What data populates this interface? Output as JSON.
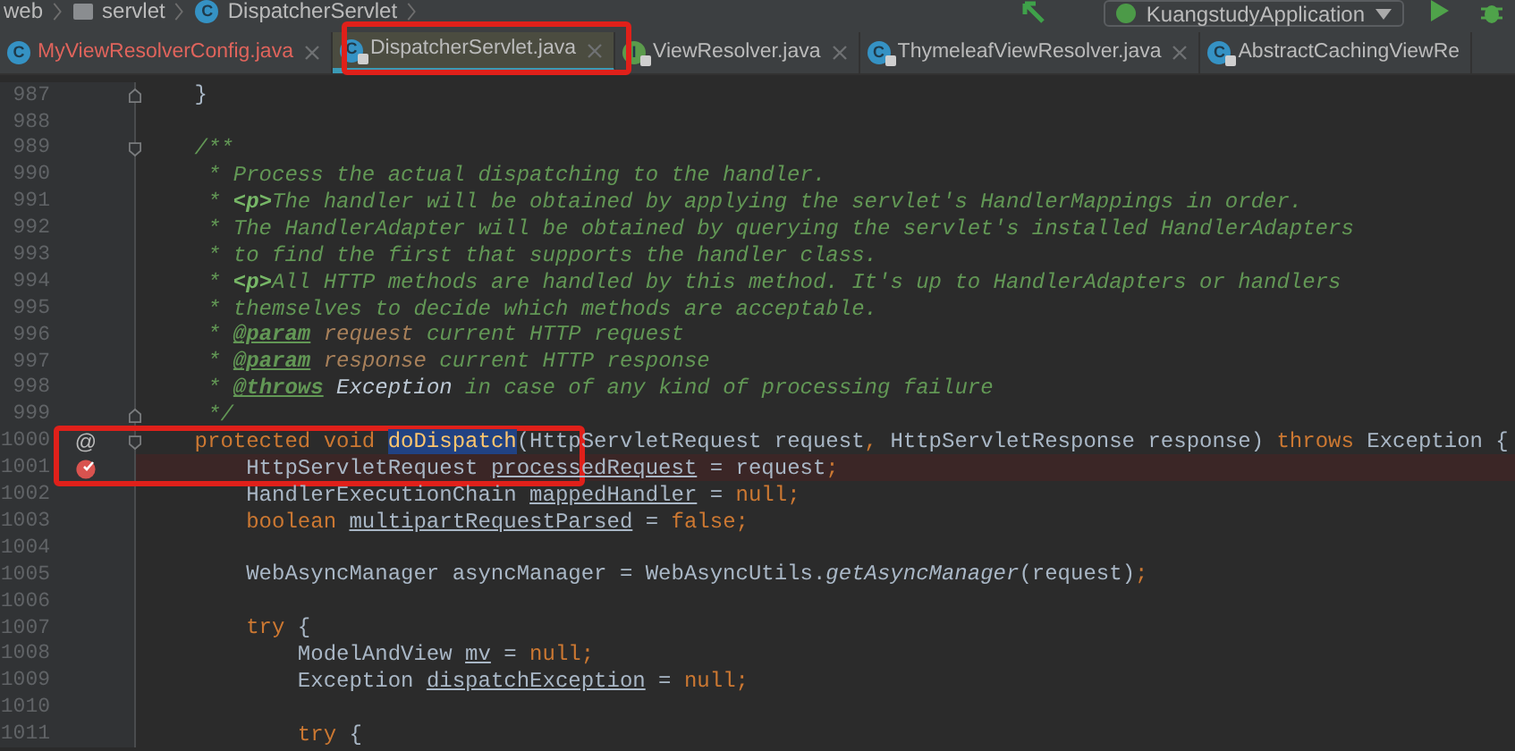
{
  "breadcrumb": [
    {
      "label": "web",
      "kind": "module"
    },
    {
      "label": "servlet",
      "kind": "package"
    },
    {
      "label": "DispatcherServlet",
      "kind": "class",
      "icon_letter": "C"
    }
  ],
  "run_config": {
    "label": "KuangstudyApplication"
  },
  "tabs": [
    {
      "label": "MyViewResolverConfig.java",
      "icon_letter": "C",
      "has_error": true,
      "locked": false,
      "selected": false,
      "closable": true
    },
    {
      "label": "DispatcherServlet.java",
      "icon_letter": "C",
      "has_error": false,
      "locked": true,
      "selected": true,
      "closable": true
    },
    {
      "label": "ViewResolver.java",
      "icon_letter": "I",
      "has_error": false,
      "locked": true,
      "selected": false,
      "closable": true
    },
    {
      "label": "ThymeleafViewResolver.java",
      "icon_letter": "C",
      "has_error": false,
      "locked": true,
      "selected": false,
      "closable": true
    },
    {
      "label": "AbstractCachingViewRe",
      "icon_letter": "C",
      "has_error": false,
      "locked": true,
      "selected": false,
      "closable": false
    }
  ],
  "lines": [
    {
      "number": "987",
      "breakpoint": false,
      "fold_start": false,
      "fold_end": true,
      "tokens": [
        {
          "text": "    }",
          "kind": "plain"
        }
      ]
    },
    {
      "number": "988",
      "breakpoint": false,
      "fold_start": false,
      "fold_end": false
    },
    {
      "number": "989",
      "breakpoint": false,
      "fold_start": true,
      "fold_end": false,
      "tokens": [
        {
          "text": "    /**",
          "kind": "comment"
        }
      ]
    },
    {
      "number": "990",
      "breakpoint": false,
      "fold_start": false,
      "fold_end": false,
      "tokens": [
        {
          "text": "     * Process the actual dispatching to the handler.",
          "kind": "comment"
        }
      ]
    },
    {
      "number": "991",
      "breakpoint": false,
      "fold_start": false,
      "fold_end": false,
      "tokens": [
        {
          "text": "     * ",
          "kind": "comment"
        },
        {
          "text": "<p>",
          "kind": "html_tag"
        },
        {
          "text": "The handler will be obtained by applying the servlet's HandlerMappings in order.",
          "kind": "comment"
        }
      ]
    },
    {
      "number": "992",
      "breakpoint": false,
      "fold_start": false,
      "fold_end": false,
      "tokens": [
        {
          "text": "     * The HandlerAdapter will be obtained by querying the servlet's installed HandlerAdapters",
          "kind": "comment"
        }
      ]
    },
    {
      "number": "993",
      "breakpoint": false,
      "fold_start": false,
      "fold_end": false,
      "tokens": [
        {
          "text": "     * to find the first that supports the handler class.",
          "kind": "comment"
        }
      ]
    },
    {
      "number": "994",
      "breakpoint": false,
      "fold_start": false,
      "fold_end": false,
      "tokens": [
        {
          "text": "     * ",
          "kind": "comment"
        },
        {
          "text": "<p>",
          "kind": "html_tag"
        },
        {
          "text": "All HTTP methods are handled by this method. It's up to HandlerAdapters or handlers",
          "kind": "comment"
        }
      ]
    },
    {
      "number": "995",
      "breakpoint": false,
      "fold_start": false,
      "fold_end": false,
      "tokens": [
        {
          "text": "     * themselves to decide which methods are acceptable.",
          "kind": "comment"
        }
      ]
    },
    {
      "number": "996",
      "breakpoint": false,
      "fold_start": false,
      "fold_end": false,
      "tokens": [
        {
          "text": "     * ",
          "kind": "comment"
        },
        {
          "text": "@param",
          "kind": "doc_tag"
        },
        {
          "text": " request",
          "kind": "doc_param"
        },
        {
          "text": " current HTTP request",
          "kind": "comment"
        }
      ]
    },
    {
      "number": "997",
      "breakpoint": false,
      "fold_start": false,
      "fold_end": false,
      "tokens": [
        {
          "text": "     * ",
          "kind": "comment"
        },
        {
          "text": "@param",
          "kind": "doc_tag"
        },
        {
          "text": " response",
          "kind": "doc_param"
        },
        {
          "text": " current HTTP response",
          "kind": "comment"
        }
      ]
    },
    {
      "number": "998",
      "breakpoint": false,
      "fold_start": false,
      "fold_end": false,
      "tokens": [
        {
          "text": "     * ",
          "kind": "comment"
        },
        {
          "text": "@throws",
          "kind": "doc_tag"
        },
        {
          "text": " Exception",
          "kind": "doc_type"
        },
        {
          "text": " in case of any kind of processing failure",
          "kind": "comment"
        }
      ]
    },
    {
      "number": "999",
      "breakpoint": false,
      "fold_start": false,
      "fold_end": true,
      "tokens": [
        {
          "text": "     */",
          "kind": "comment"
        }
      ]
    },
    {
      "number": "1000",
      "breakpoint": false,
      "fold_start": true,
      "fold_end": false,
      "marker": "@",
      "tokens": [
        {
          "text": "    protected void ",
          "kind": "keyword"
        },
        {
          "text": "doDispatch",
          "kind": "method_selected"
        },
        {
          "text": "(HttpServletRequest request",
          "kind": "plain"
        },
        {
          "text": ", ",
          "kind": "keyword"
        },
        {
          "text": "HttpServletResponse response) ",
          "kind": "plain"
        },
        {
          "text": "throws ",
          "kind": "keyword"
        },
        {
          "text": "Exception {",
          "kind": "plain"
        }
      ]
    },
    {
      "number": "1001",
      "breakpoint": true,
      "fold_start": false,
      "fold_end": false,
      "tokens": [
        {
          "text": "        HttpServletRequest ",
          "kind": "plain"
        },
        {
          "text": "processedRequest",
          "kind": "field"
        },
        {
          "text": " = request",
          "kind": "plain"
        },
        {
          "text": ";",
          "kind": "keyword"
        }
      ]
    },
    {
      "number": "1002",
      "breakpoint": false,
      "fold_start": false,
      "fold_end": false,
      "tokens": [
        {
          "text": "        HandlerExecutionChain ",
          "kind": "plain"
        },
        {
          "text": "mappedHandler",
          "kind": "field"
        },
        {
          "text": " = ",
          "kind": "plain"
        },
        {
          "text": "null;",
          "kind": "keyword"
        }
      ]
    },
    {
      "number": "1003",
      "breakpoint": false,
      "fold_start": false,
      "fold_end": false,
      "tokens": [
        {
          "text": "        boolean ",
          "kind": "keyword"
        },
        {
          "text": "multipartRequestParsed",
          "kind": "field"
        },
        {
          "text": " = ",
          "kind": "plain"
        },
        {
          "text": "false;",
          "kind": "keyword"
        }
      ]
    },
    {
      "number": "1004",
      "breakpoint": false,
      "fold_start": false,
      "fold_end": false
    },
    {
      "number": "1005",
      "breakpoint": false,
      "fold_start": false,
      "fold_end": false,
      "tokens": [
        {
          "text": "        WebAsyncManager asyncManager = WebAsyncUtils.",
          "kind": "plain"
        },
        {
          "text": "getAsyncManager",
          "kind": "static_call"
        },
        {
          "text": "(request)",
          "kind": "plain"
        },
        {
          "text": ";",
          "kind": "keyword"
        }
      ]
    },
    {
      "number": "1006",
      "breakpoint": false,
      "fold_start": false,
      "fold_end": false
    },
    {
      "number": "1007",
      "breakpoint": false,
      "fold_start": false,
      "fold_end": false,
      "tokens": [
        {
          "text": "        try ",
          "kind": "keyword"
        },
        {
          "text": "{",
          "kind": "plain"
        }
      ]
    },
    {
      "number": "1008",
      "breakpoint": false,
      "fold_start": false,
      "fold_end": false,
      "tokens": [
        {
          "text": "            ModelAndView ",
          "kind": "plain"
        },
        {
          "text": "mv",
          "kind": "field"
        },
        {
          "text": " = ",
          "kind": "plain"
        },
        {
          "text": "null;",
          "kind": "keyword"
        }
      ]
    },
    {
      "number": "1009",
      "breakpoint": false,
      "fold_start": false,
      "fold_end": false,
      "tokens": [
        {
          "text": "            Exception ",
          "kind": "plain"
        },
        {
          "text": "dispatchException",
          "kind": "field"
        },
        {
          "text": " = ",
          "kind": "plain"
        },
        {
          "text": "null;",
          "kind": "keyword"
        }
      ]
    },
    {
      "number": "1010",
      "breakpoint": false,
      "fold_start": false,
      "fold_end": false
    },
    {
      "number": "1011",
      "breakpoint": false,
      "fold_start": false,
      "fold_end": false,
      "tokens": [
        {
          "text": "            try ",
          "kind": "keyword"
        },
        {
          "text": "{",
          "kind": "plain"
        }
      ]
    }
  ]
}
